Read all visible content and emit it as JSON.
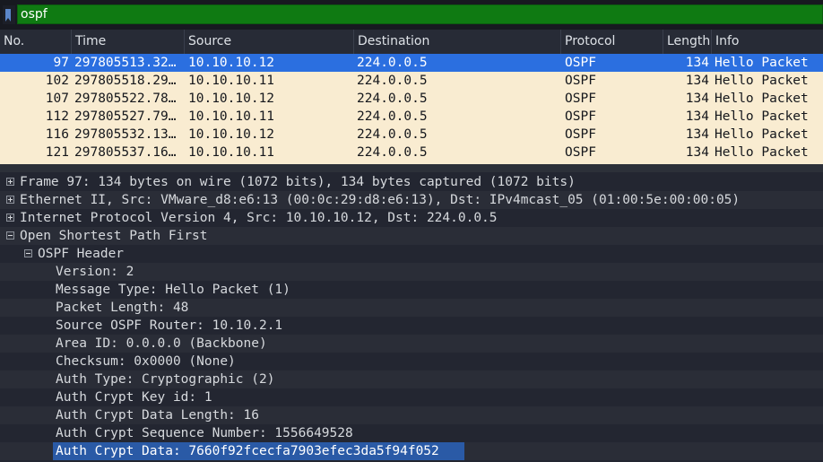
{
  "filter": {
    "value": "ospf"
  },
  "columns": {
    "no": "No.",
    "time": "Time",
    "source": "Source",
    "destination": "Destination",
    "protocol": "Protocol",
    "length": "Length",
    "info": "Info"
  },
  "packets": [
    {
      "no": "97",
      "time": "297805513.32…",
      "source": "10.10.10.12",
      "destination": "224.0.0.5",
      "protocol": "OSPF",
      "length": "134",
      "info": "Hello Packet"
    },
    {
      "no": "102",
      "time": "297805518.29…",
      "source": "10.10.10.11",
      "destination": "224.0.0.5",
      "protocol": "OSPF",
      "length": "134",
      "info": "Hello Packet"
    },
    {
      "no": "107",
      "time": "297805522.78…",
      "source": "10.10.10.12",
      "destination": "224.0.0.5",
      "protocol": "OSPF",
      "length": "134",
      "info": "Hello Packet"
    },
    {
      "no": "112",
      "time": "297805527.79…",
      "source": "10.10.10.11",
      "destination": "224.0.0.5",
      "protocol": "OSPF",
      "length": "134",
      "info": "Hello Packet"
    },
    {
      "no": "116",
      "time": "297805532.13…",
      "source": "10.10.10.12",
      "destination": "224.0.0.5",
      "protocol": "OSPF",
      "length": "134",
      "info": "Hello Packet"
    },
    {
      "no": "121",
      "time": "297805537.16…",
      "source": "10.10.10.11",
      "destination": "224.0.0.5",
      "protocol": "OSPF",
      "length": "134",
      "info": "Hello Packet"
    }
  ],
  "selected_packet": "97",
  "details": [
    {
      "text": "Frame 97: 134 bytes on wire (1072 bits), 134 bytes captured (1072 bits)",
      "expander": "collapsed"
    },
    {
      "text": "Ethernet II, Src: VMware_d8:e6:13 (00:0c:29:d8:e6:13), Dst: IPv4mcast_05 (01:00:5e:00:00:05)",
      "expander": "collapsed"
    },
    {
      "text": "Internet Protocol Version 4, Src: 10.10.10.12, Dst: 224.0.0.5",
      "expander": "collapsed"
    },
    {
      "text": "Open Shortest Path First",
      "expander": "expanded"
    },
    {
      "text": "OSPF Header",
      "expander": "expanded"
    },
    {
      "text": "Version: 2"
    },
    {
      "text": "Message Type: Hello Packet (1)"
    },
    {
      "text": "Packet Length: 48"
    },
    {
      "text": "Source OSPF Router: 10.10.2.1"
    },
    {
      "text": "Area ID: 0.0.0.0 (Backbone)"
    },
    {
      "text": "Checksum: 0x0000 (None)"
    },
    {
      "text": "Auth Type: Cryptographic (2)"
    },
    {
      "text": "Auth Crypt Key id: 1"
    },
    {
      "text": "Auth Crypt Data Length: 16"
    },
    {
      "text": "Auth Crypt Sequence Number: 1556649528"
    },
    {
      "text": "Auth Crypt Data: 7660f92fcecfa7903efec3da5f94f052",
      "highlighted": true
    }
  ],
  "colors": {
    "filter_valid": "#0f7a12",
    "row_ospf": "#f9ecd1",
    "row_selected": "#2b6fe0",
    "detail_selected": "#2a5aa6"
  }
}
